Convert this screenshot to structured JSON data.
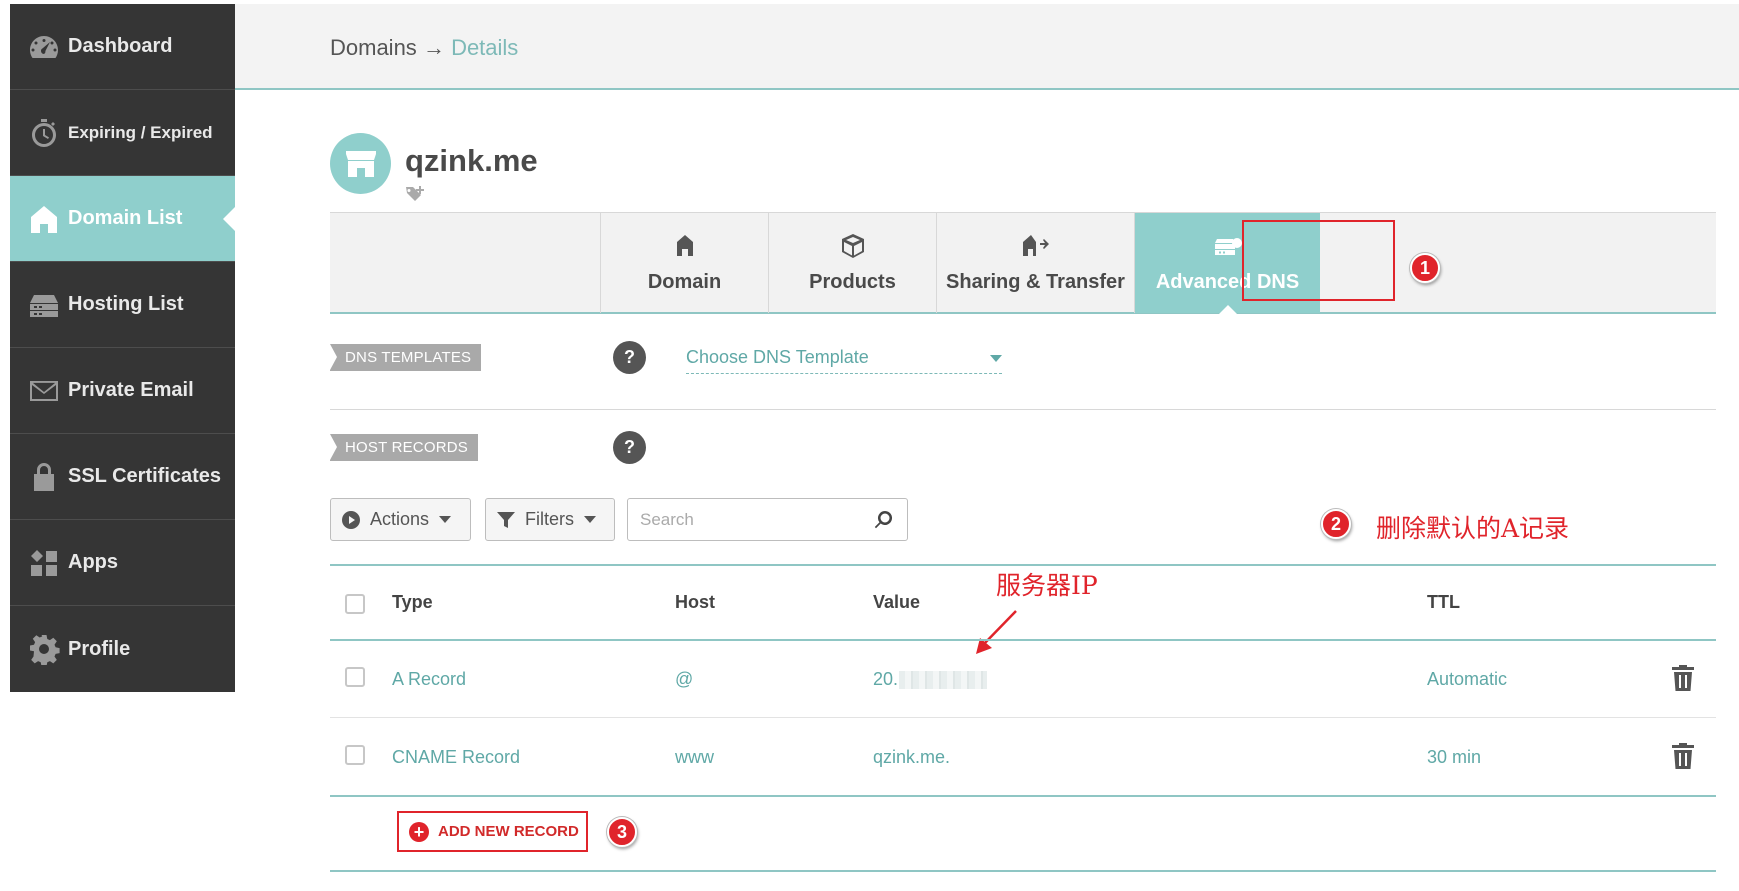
{
  "sidebar": {
    "items": [
      {
        "label": "Dashboard",
        "icon": "gauge-icon"
      },
      {
        "label": "Expiring / Expired",
        "icon": "stopwatch-icon"
      },
      {
        "label": "Domain List",
        "icon": "home-icon",
        "active": true
      },
      {
        "label": "Hosting List",
        "icon": "server-icon"
      },
      {
        "label": "Private Email",
        "icon": "envelope-icon"
      },
      {
        "label": "SSL Certificates",
        "icon": "lock-icon"
      },
      {
        "label": "Apps",
        "icon": "apps-icon"
      },
      {
        "label": "Profile",
        "icon": "gear-icon"
      }
    ]
  },
  "header": {
    "breadcrumb_root": "Domains",
    "breadcrumb_sep": "→",
    "breadcrumb_current": "Details"
  },
  "domain": {
    "name": "qzink.me"
  },
  "tabs": [
    {
      "label": "Domain",
      "icon": "home-icon"
    },
    {
      "label": "Products",
      "icon": "box-icon"
    },
    {
      "label": "Sharing & Transfer",
      "icon": "transfer-icon"
    },
    {
      "label": "Advanced DNS",
      "icon": "dns-icon",
      "active": true
    }
  ],
  "dns_templates": {
    "label": "DNS TEMPLATES",
    "help": "?",
    "select_value": "Choose DNS Template"
  },
  "host_records": {
    "label": "HOST RECORDS",
    "help": "?"
  },
  "toolbar": {
    "actions_label": "Actions",
    "filters_label": "Filters",
    "search_placeholder": "Search"
  },
  "table": {
    "columns": {
      "type": "Type",
      "host": "Host",
      "value": "Value",
      "ttl": "TTL"
    },
    "rows": [
      {
        "type": "A Record",
        "host": "@",
        "value": "20.",
        "ttl": "Automatic"
      },
      {
        "type": "CNAME Record",
        "host": "www",
        "value": "qzink.me.",
        "ttl": "30 min"
      }
    ]
  },
  "add_record_label": "ADD NEW RECORD",
  "annotations": {
    "badge1": "1",
    "badge2": "2",
    "badge3": "3",
    "delete_note": "删除默认的A记录",
    "server_ip": "服务器IP"
  },
  "colors": {
    "accent": "#8fcfcc",
    "sidebar_bg": "#353535",
    "link_text": "#5fa8a6",
    "annotation_red": "#e0242b"
  }
}
